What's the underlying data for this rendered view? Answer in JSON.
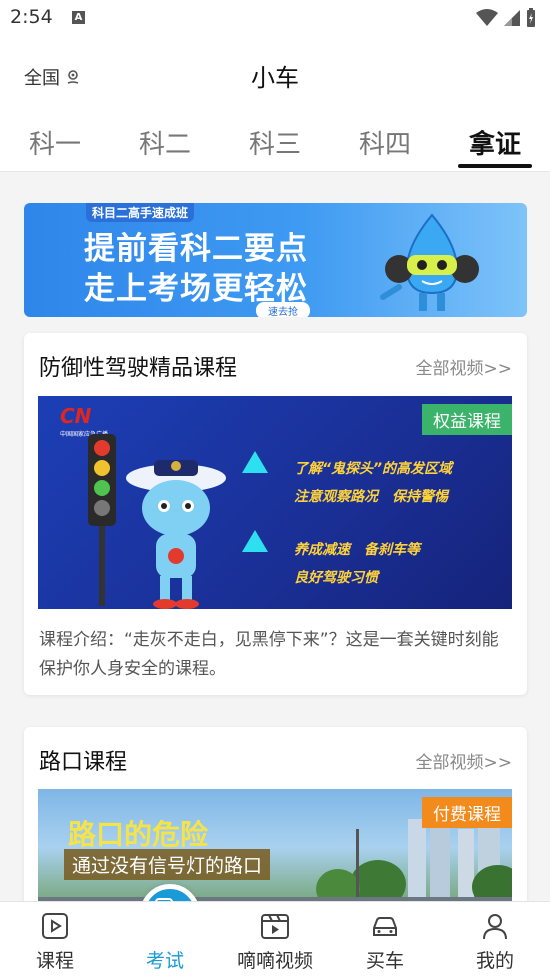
{
  "status_bar": {
    "time": "2:54",
    "notification_icon": "A"
  },
  "header": {
    "region": "全国",
    "title": "小车",
    "tabs": [
      "科一",
      "科二",
      "科三",
      "科四",
      "拿证"
    ],
    "active_tab": "拿证"
  },
  "banner": {
    "tag": "科目二高手速成班",
    "line1": "提前看科二要点",
    "line2": "走上考场更轻松",
    "cta": "速去抢"
  },
  "cards": [
    {
      "title": "防御性驾驶精品课程",
      "more": "全部视频>>",
      "badge": "权益课程",
      "badge_color": "#3bb36a",
      "video_logo": "CN",
      "video_logo_sub": "中国国家应急广播",
      "video_lines": [
        "了解“鬼探头”的高发区域",
        "注意观察路况　保持警惕",
        "养成减速　备刹车等",
        "良好驾驶习惯"
      ],
      "description": "课程介绍：“走灰不走白，见黑停下来”？这是一套关键时刻能保护你人身安全的课程。"
    },
    {
      "title": "路口课程",
      "more": "全部视频>>",
      "badge": "付费课程",
      "badge_color": "#f28a1c",
      "video_title": "路口的危险",
      "video_subtitle": "通过没有信号灯的路口"
    }
  ],
  "nav": {
    "items": [
      {
        "label": "课程",
        "icon": "course-icon"
      },
      {
        "label": "考试",
        "icon": "exam-icon"
      },
      {
        "label": "嘀嘀视频",
        "icon": "video-icon"
      },
      {
        "label": "买车",
        "icon": "car-icon"
      },
      {
        "label": "我的",
        "icon": "profile-icon"
      }
    ],
    "active": "考试",
    "accent": "#1a9ad6"
  }
}
